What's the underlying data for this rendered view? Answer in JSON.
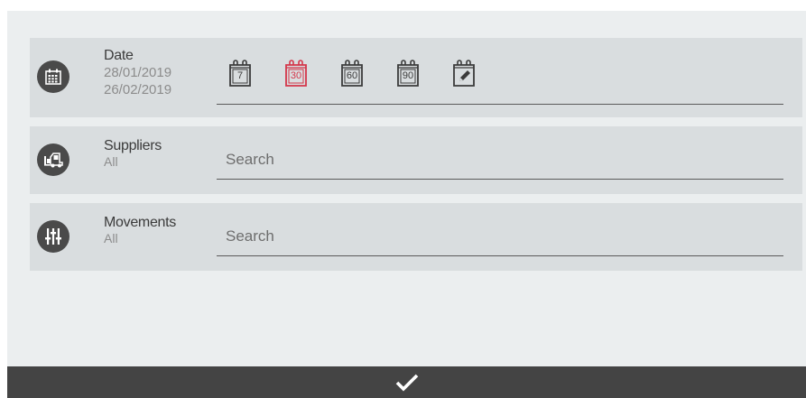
{
  "filters": {
    "date": {
      "title": "Date",
      "from": "28/01/2019",
      "to": "26/02/2019",
      "icon": "calendar-grid-icon",
      "presets": [
        {
          "label": "7",
          "active": false
        },
        {
          "label": "30",
          "active": true
        },
        {
          "label": "60",
          "active": false
        },
        {
          "label": "90",
          "active": false
        }
      ],
      "custom_icon": "calendar-edit-icon"
    },
    "suppliers": {
      "title": "Suppliers",
      "value": "All",
      "icon": "forklift-icon",
      "placeholder": "Search"
    },
    "movements": {
      "title": "Movements",
      "value": "All",
      "icon": "sliders-icon",
      "placeholder": "Search"
    }
  },
  "footer": {
    "icon": "checkmark-icon"
  },
  "colors": {
    "active_preset": "#d4364a",
    "icon_circle": "#4a4a4a",
    "footer": "#444444",
    "row_bg": "#d9dddf",
    "panel_bg": "#ebeeef"
  }
}
